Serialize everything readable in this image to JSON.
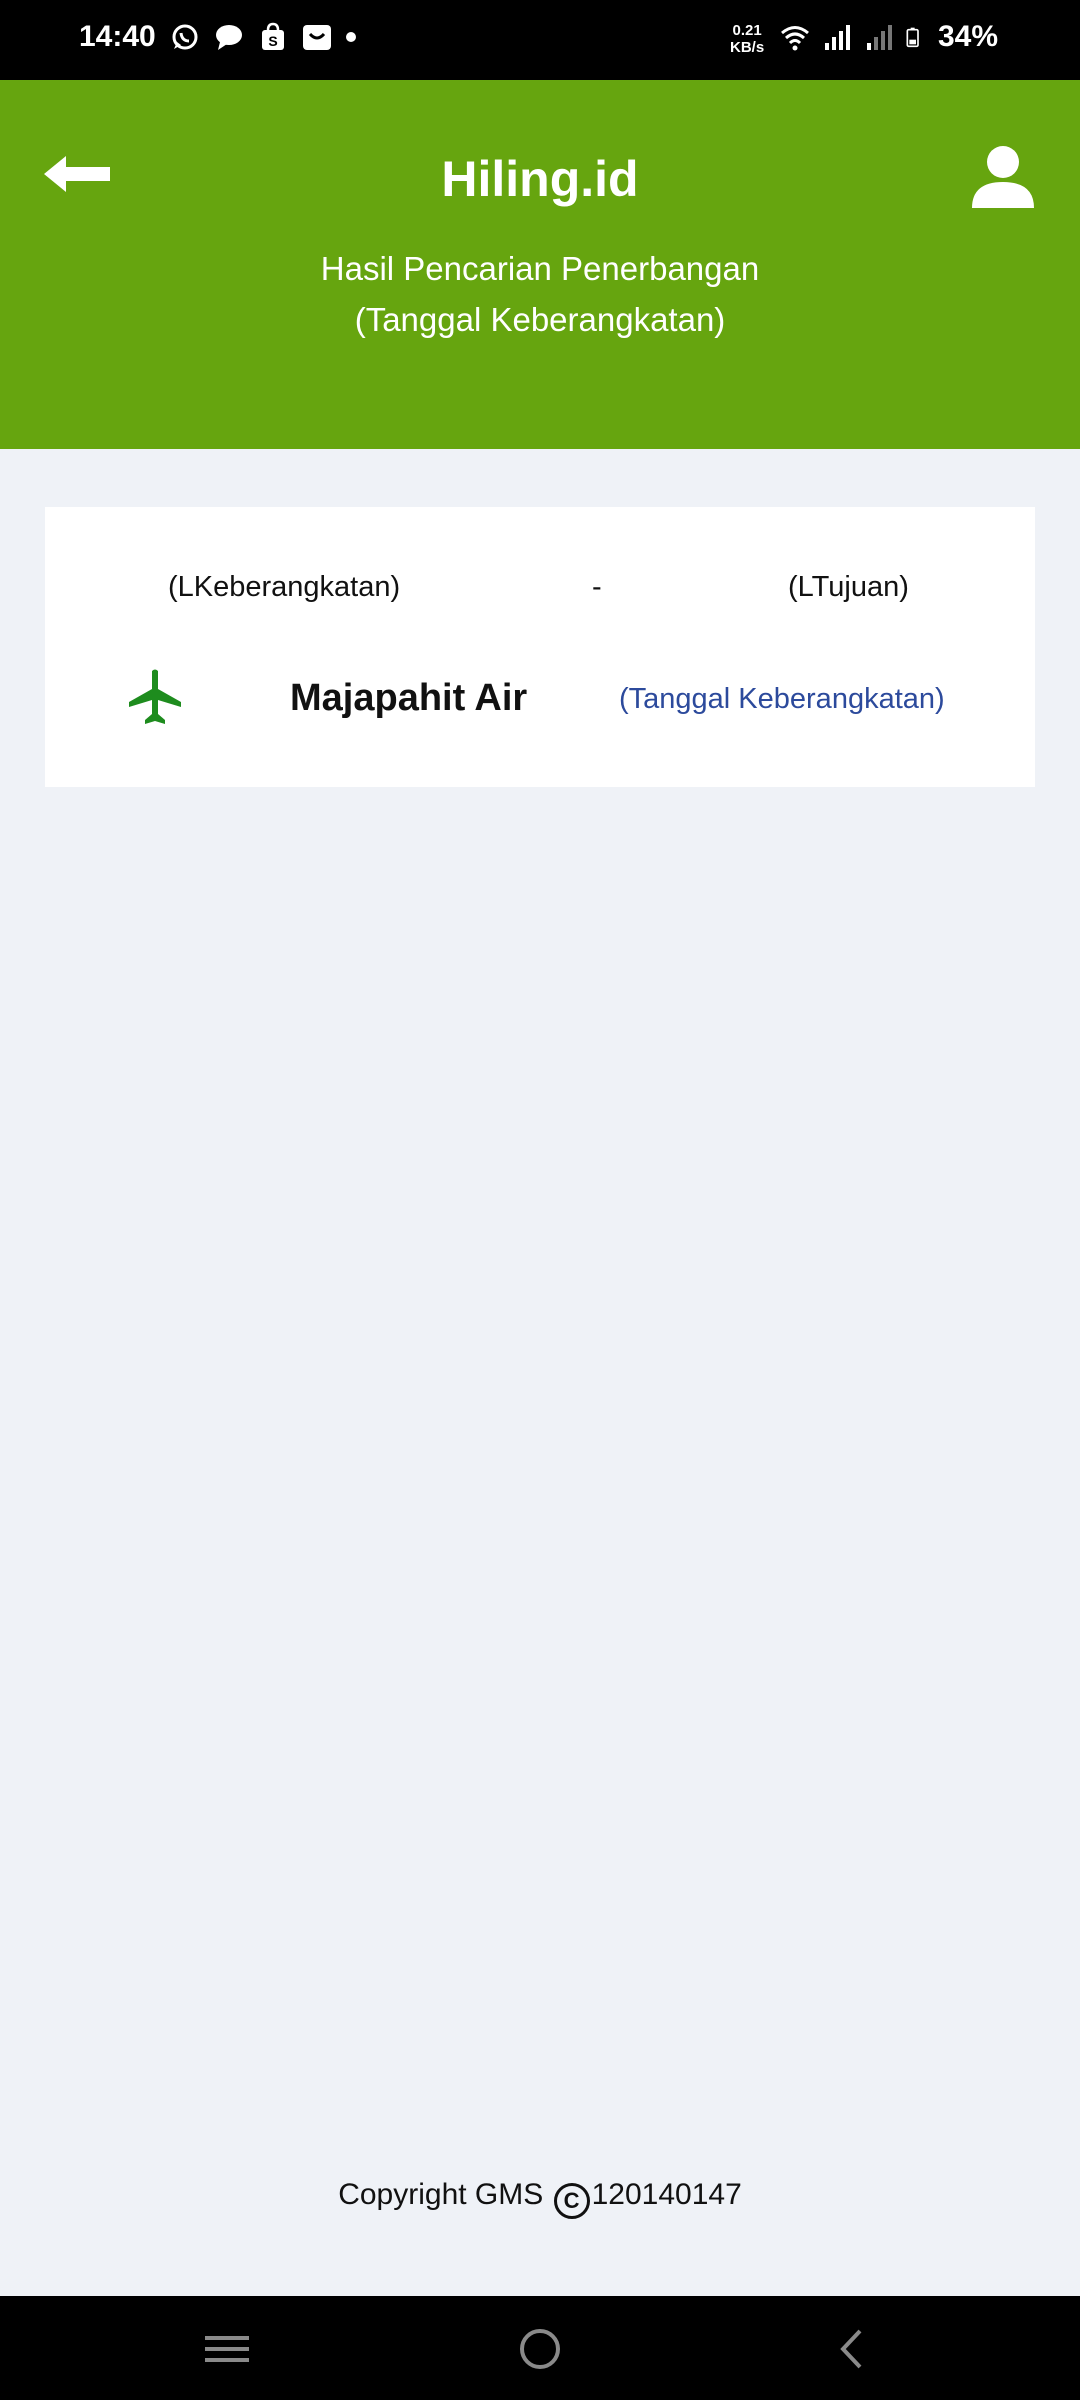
{
  "status_bar": {
    "time": "14:40",
    "network_speed_value": "0.21",
    "network_speed_unit": "KB/s",
    "battery": "34%",
    "icons": [
      "whatsapp-icon",
      "message-icon",
      "shopping-bag-icon",
      "mail-icon",
      "notification-dot",
      "wifi-icon",
      "signal-icon",
      "signal-weak-icon",
      "battery-icon"
    ]
  },
  "header": {
    "title": "Hiling.id",
    "subtitle_line1": "Hasil Pencarian Penerbangan",
    "subtitle_line2": "(Tanggal Keberangkatan)",
    "back_icon": "arrow-left-icon",
    "profile_icon": "user-icon",
    "background_color": "#66a50f"
  },
  "results": [
    {
      "origin": "(LKeberangkatan)",
      "separator": "-",
      "destination": "(LTujuan)",
      "airline": "Majapahit Air",
      "date": "(Tanggal Keberangkatan)",
      "icon": "airplane-icon",
      "icon_color": "#1e8c1e",
      "date_color": "#2c4a9c"
    }
  ],
  "footer": {
    "copyright_prefix": "Copyright GMS",
    "copyright_symbol": "C",
    "copyright_id": "120140147"
  },
  "nav_bar": {
    "buttons": [
      "menu-icon",
      "home-icon",
      "back-icon"
    ]
  }
}
